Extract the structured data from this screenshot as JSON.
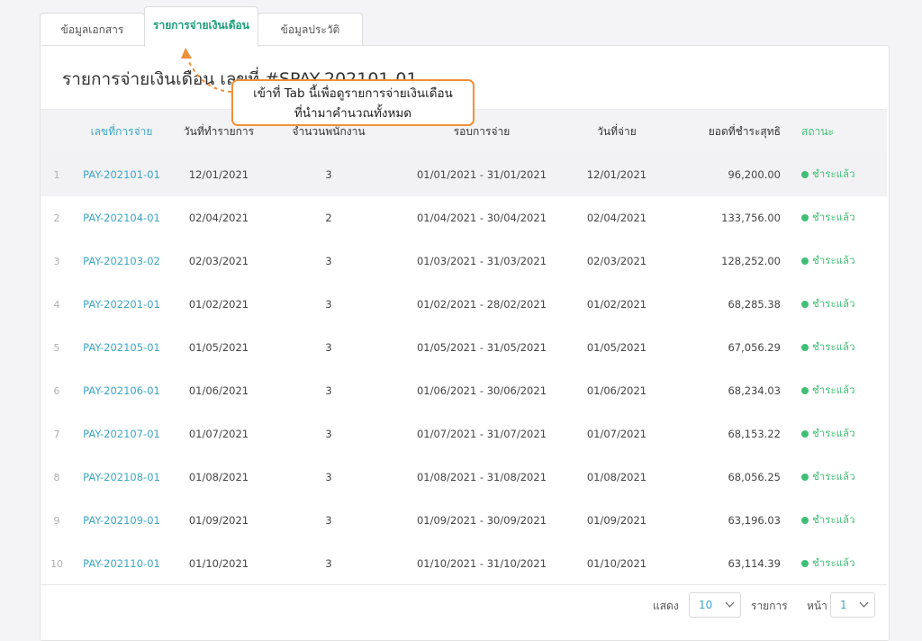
{
  "tabs": [
    {
      "label": "ข้อมูลเอกสาร"
    },
    {
      "label": "รายการจ่ายเงินเดือน"
    },
    {
      "label": "ข้อมูลประวัติ"
    }
  ],
  "page_title": "รายการจ่ายเงินเดือน เลขที่ #SPAY-202101-01",
  "callout": {
    "line1": "เข้าที่ Tab นี้เพื่อดูรายการจ่ายเงินเดือน",
    "line2": "ที่นำมาคำนวณทั้งหมด",
    "color": "#f0903a"
  },
  "table": {
    "headers": {
      "no": "เลขที่การจ่าย",
      "doc_date": "วันที่ทำรายการ",
      "employees": "จำนวนพนักงาน",
      "period": "รอบการจ่าย",
      "paid_date": "วันที่จ่าย",
      "net": "ยอดที่ชำระสุทธิ",
      "status": "สถานะ"
    },
    "rows": [
      {
        "idx": "1",
        "no": "PAY-202101-01",
        "doc_date": "12/01/2021",
        "employees": "3",
        "period": "01/01/2021 - 31/01/2021",
        "paid_date": "12/01/2021",
        "net": "96,200.00",
        "status": "ชำระแล้ว"
      },
      {
        "idx": "2",
        "no": "PAY-202104-01",
        "doc_date": "02/04/2021",
        "employees": "2",
        "period": "01/04/2021 - 30/04/2021",
        "paid_date": "02/04/2021",
        "net": "133,756.00",
        "status": "ชำระแล้ว"
      },
      {
        "idx": "3",
        "no": "PAY-202103-02",
        "doc_date": "02/03/2021",
        "employees": "3",
        "period": "01/03/2021 - 31/03/2021",
        "paid_date": "02/03/2021",
        "net": "128,252.00",
        "status": "ชำระแล้ว"
      },
      {
        "idx": "4",
        "no": "PAY-202201-01",
        "doc_date": "01/02/2021",
        "employees": "3",
        "period": "01/02/2021 - 28/02/2021",
        "paid_date": "01/02/2021",
        "net": "68,285.38",
        "status": "ชำระแล้ว"
      },
      {
        "idx": "5",
        "no": "PAY-202105-01",
        "doc_date": "01/05/2021",
        "employees": "3",
        "period": "01/05/2021 - 31/05/2021",
        "paid_date": "01/05/2021",
        "net": "67,056.29",
        "status": "ชำระแล้ว"
      },
      {
        "idx": "6",
        "no": "PAY-202106-01",
        "doc_date": "01/06/2021",
        "employees": "3",
        "period": "01/06/2021 - 30/06/2021",
        "paid_date": "01/06/2021",
        "net": "68,234.03",
        "status": "ชำระแล้ว"
      },
      {
        "idx": "7",
        "no": "PAY-202107-01",
        "doc_date": "01/07/2021",
        "employees": "3",
        "period": "01/07/2021 - 31/07/2021",
        "paid_date": "01/07/2021",
        "net": "68,153.22",
        "status": "ชำระแล้ว"
      },
      {
        "idx": "8",
        "no": "PAY-202108-01",
        "doc_date": "01/08/2021",
        "employees": "3",
        "period": "01/08/2021 - 31/08/2021",
        "paid_date": "01/08/2021",
        "net": "68,056.25",
        "status": "ชำระแล้ว"
      },
      {
        "idx": "9",
        "no": "PAY-202109-01",
        "doc_date": "01/09/2021",
        "employees": "3",
        "period": "01/09/2021 - 30/09/2021",
        "paid_date": "01/09/2021",
        "net": "63,196.03",
        "status": "ชำระแล้ว"
      },
      {
        "idx": "10",
        "no": "PAY-202110-01",
        "doc_date": "01/10/2021",
        "employees": "3",
        "period": "01/10/2021 - 31/10/2021",
        "paid_date": "01/10/2021",
        "net": "63,114.39",
        "status": "ชำระแล้ว"
      }
    ]
  },
  "footer": {
    "show_label": "แสดง",
    "page_size": "10",
    "items_label": "รายการ",
    "page_label": "หน้า",
    "page": "1"
  },
  "colors": {
    "link": "#3ca6c4",
    "status_paid": "#3fbf75",
    "active_tab": "#1a9e78"
  },
  "icons": [
    "status-dot-icon",
    "chevron-down-icon",
    "arrow-up-icon"
  ]
}
